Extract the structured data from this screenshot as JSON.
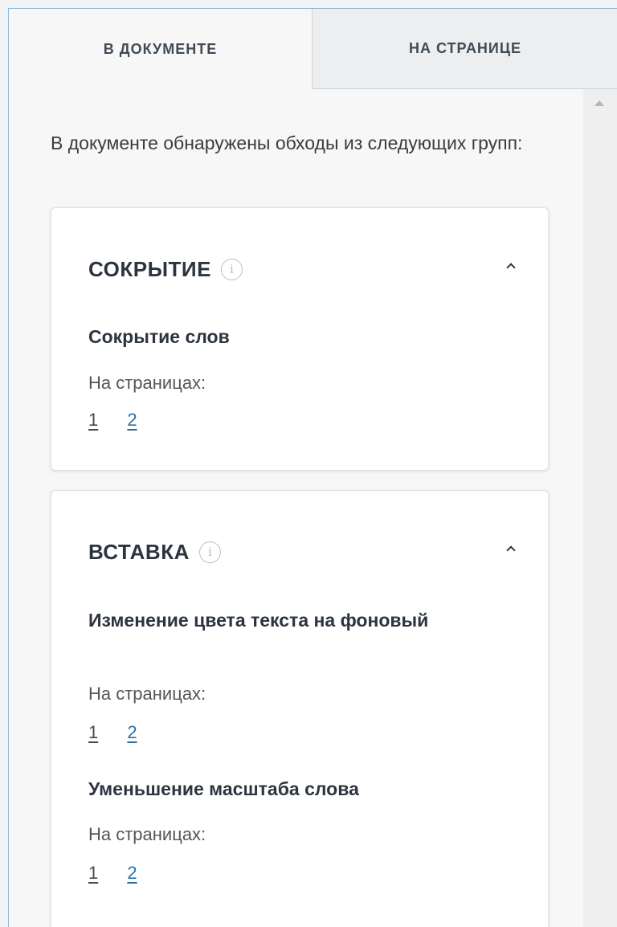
{
  "tabs": {
    "active": "В ДОКУМЕНТЕ",
    "inactive": "НА СТРАНИЦЕ"
  },
  "intro_text": "В документе обнаружены обходы из следующих групп:",
  "groups": [
    {
      "title": "СОКРЫТИЕ",
      "info_icon": "info-icon",
      "items": [
        {
          "title": "Сокрытие слов",
          "pages_label": "На страницах:",
          "pages": [
            "1",
            "2"
          ]
        }
      ]
    },
    {
      "title": "ВСТАВКА",
      "info_icon": "info-icon",
      "items": [
        {
          "title": "Изменение цвета текста на фоновый",
          "pages_label": "На страницах:",
          "pages": [
            "1",
            "2"
          ]
        },
        {
          "title": "Уменьшение масштаба слова",
          "pages_label": "На страницах:",
          "pages": [
            "1",
            "2"
          ]
        }
      ]
    }
  ],
  "colors": {
    "accent_link": "#2a6fa8",
    "frame_border": "#8fb6d8"
  }
}
